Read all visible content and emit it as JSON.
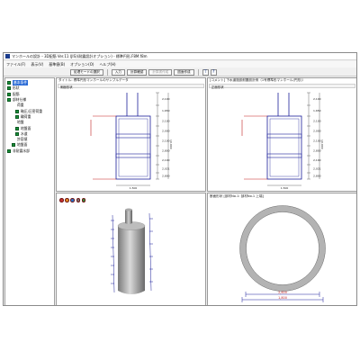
{
  "window": {
    "title": "マンホールの設計・3D配筋 Ver.11 (JIS)(耐震設計オプション) - 標準円形.F8M.f8m"
  },
  "menu": {
    "items": [
      "ファイル(F)",
      "表示(V)",
      "基準値(B)",
      "オプション(O)",
      "ヘルプ(H)"
    ]
  },
  "toolbar": {
    "mode_button": "処理モードの選択",
    "input_button": "入力",
    "calc_button": "計算確認",
    "report_button": "計算書作成",
    "drawing_button": "図面作成"
  },
  "tree": {
    "items": [
      {
        "label": "基本条件",
        "level": 0,
        "selected": true,
        "checked": true
      },
      {
        "label": "形状",
        "level": 0,
        "checked": true
      },
      {
        "label": "配筋",
        "level": 0,
        "checked": true
      },
      {
        "label": "部材仕様",
        "level": 0,
        "checked": true
      },
      {
        "label": "荷重",
        "level": 1,
        "checked": false
      },
      {
        "label": "軸圧/圧密荷重",
        "level": 2,
        "checked": true
      },
      {
        "label": "輪荷重",
        "level": 2,
        "checked": true
      },
      {
        "label": "地盤",
        "level": 1,
        "checked": false
      },
      {
        "label": "地盤面",
        "level": 2,
        "checked": true
      },
      {
        "label": "水道",
        "level": 2,
        "checked": true
      },
      {
        "label": "許容値",
        "level": 1,
        "checked": false
      },
      {
        "label": "地盤面",
        "level": 1,
        "checked": true
      },
      {
        "label": "非耐震水部",
        "level": 0,
        "checked": true
      }
    ]
  },
  "panes": {
    "top_left": {
      "header": "タイトル:  標準円形マンホールのサンプルデータ",
      "subtitle": "側面形状",
      "dims": [
        "2,100",
        "1,650",
        "2,100",
        "2,000",
        "2,100",
        "2,800",
        "2,100",
        "2,021",
        "2,800"
      ],
      "total": "10,000",
      "width": "1,500"
    },
    "top_right": {
      "header": "[コメント]  下水道施設耐震設計例（1号標準形マンホール(円形)）",
      "subtitle": "正面形状",
      "dims": [
        "2,100",
        "1,650",
        "2,100",
        "2,000",
        "2,100",
        "2,800",
        "2,100",
        "2,021",
        "2,800"
      ],
      "total": "10,000",
      "width": "1,500"
    },
    "bottom_left": {
      "icons": [
        "red-icon",
        "orange-icon",
        "blue-icon",
        "gray-icon",
        "green-icon"
      ]
    },
    "bottom_right": {
      "header": "断面形状",
      "subheader": "[部材No.1: 部材No.1 上端]",
      "dim_inner": "2,600",
      "dim_outer": "1,800"
    }
  },
  "colors": {
    "structure": "#1b1f9a",
    "dimension": "#c21e1e",
    "tree_check": "#1a8f3a",
    "selection": "#2a6bd6"
  }
}
